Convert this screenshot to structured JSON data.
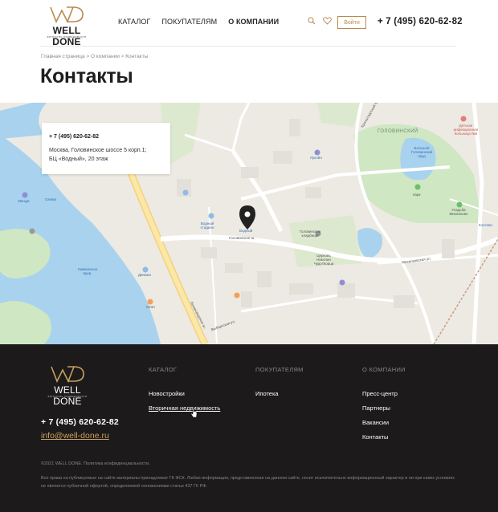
{
  "header": {
    "logo_text": "WELL DONE",
    "logo_sub": "агентство недвижимости",
    "nav": [
      "КАТАЛОГ",
      "ПОКУПАТЕЛЯМ",
      "О КОМПАНИИ"
    ],
    "active_nav": "О КОМПАНИИ",
    "login_label": "Войти",
    "phone": "+ 7 (495) 620-62-82"
  },
  "breadcrumb": {
    "items": [
      "Главная страница",
      "О компании",
      "Контакты"
    ],
    "separator": " > "
  },
  "page_title": "Контакты",
  "map": {
    "card_phone": "+ 7 (495) 620-62-82",
    "card_address_1": "Москва, Головинское шоссе 5 корп.1;",
    "card_address_2": "БЦ «Водный», 20 этаж",
    "labels": {
      "golovinsky": "ГОЛОВИНСКИЙ",
      "big_pond": "Большой Головинский пруд",
      "vodny_stadion": "Водный стадион",
      "vodny": "Водный",
      "golovinskoe_sh": "Головинское ш.",
      "leningradskoe_sh": "Ленинградское ш.",
      "khimki": "Химкинское вдхр.",
      "dinamo": "Динамо",
      "ozon": "Ozon",
      "lukoil": "Лукойл",
      "koptevo": "Коптево",
      "golov_cemetery": "Головинское кладбище",
      "michalkovo": "Усадьба Михалково",
      "mikhalkovskaya": "Михалковская ул.",
      "kronshtadtsky": "Кронштадтский бул.",
      "vyborgskaya": "Выборгская ул.",
      "church": "Церковь Николая Чудотворца",
      "detskaya": "Детская инфекционная больница №6",
      "zvezda": "Звезда",
      "olimp": "Олимп",
      "park": "парк"
    },
    "accent_color": "#3a6fb4"
  },
  "footer": {
    "logo_text": "WELL DONE",
    "logo_sub": "агентство недвижимости",
    "columns": [
      {
        "header": "КАТАЛОГ",
        "items": [
          "Новостройки",
          "Вторичная недвижимость"
        ]
      },
      {
        "header": "ПОКУПАТЕЛЯМ",
        "items": [
          "Ипотека"
        ]
      },
      {
        "header": "О КОМПАНИИ",
        "items": [
          "Пресс-центр",
          "Партнеры",
          "Вакансии",
          "Контакты"
        ]
      }
    ],
    "phone": "+ 7 (495) 620-62-82",
    "email": "info@well-done.ru",
    "copyright": "©2021 WELL DONE.",
    "policy": "Политика конфиденциальности.",
    "note": "Все права на публикуемые на сайте материалы принадлежат ГК ФСК. Любая информация, представленная на данном сайте, носит исключительно информационный характер и ни при каких условиях не является публичной офертой, определяемой положениями статьи 437 ГК РФ."
  },
  "colors": {
    "gold": "#b88a4e",
    "footer_bg": "#1c1a1a",
    "water": "#a9d2ee",
    "park": "#cfe7c2"
  },
  "icons": [
    "search-icon",
    "heart-icon",
    "map-pin-icon",
    "cursor-icon"
  ]
}
